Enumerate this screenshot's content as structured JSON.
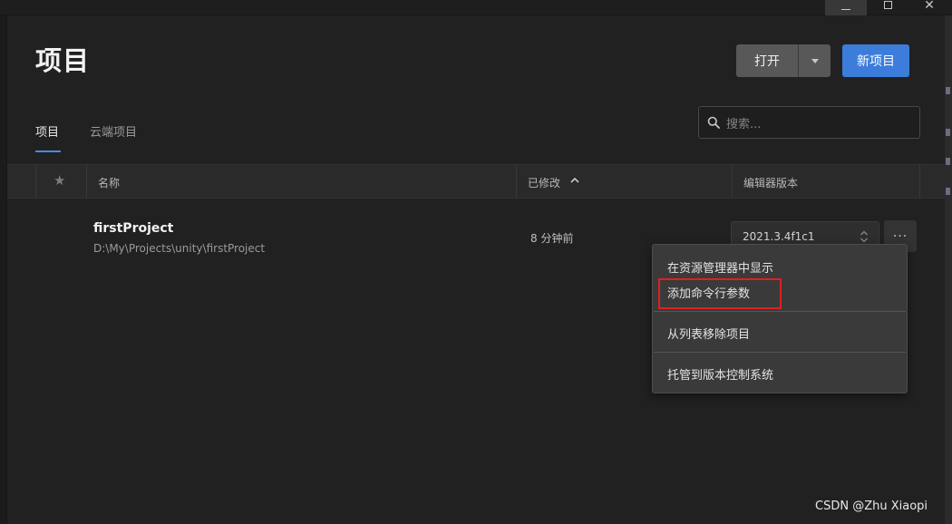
{
  "window": {
    "controls": {
      "minimize_icon": "minimize-icon",
      "maximize_icon": "maximize-icon",
      "close_icon": "close-icon"
    }
  },
  "header": {
    "title": "项目",
    "open_label": "打开",
    "new_project_label": "新项目",
    "accent_color": "#3c7ddb"
  },
  "tabs": [
    {
      "label": "项目",
      "active": true
    },
    {
      "label": "云端项目",
      "active": false
    }
  ],
  "search": {
    "placeholder": "搜索..."
  },
  "table": {
    "columns": {
      "star": "★",
      "name": "名称",
      "modified": "已修改",
      "editor_version": "编辑器版本"
    },
    "sort": {
      "column": "已修改",
      "direction": "ascending"
    },
    "rows": [
      {
        "name": "firstProject",
        "path": "D:\\My\\Projects\\unity\\firstProject",
        "modified": "8 分钟前",
        "editor_version": "2021.3.4f1c1"
      }
    ]
  },
  "context_menu": {
    "items": [
      "在资源管理器中显示",
      "添加命令行参数",
      "从列表移除项目",
      "托管到版本控制系统"
    ],
    "highlighted": "添加命令行参数",
    "highlight_color": "#e02020"
  },
  "watermark": "CSDN @Zhu Xiaopi"
}
